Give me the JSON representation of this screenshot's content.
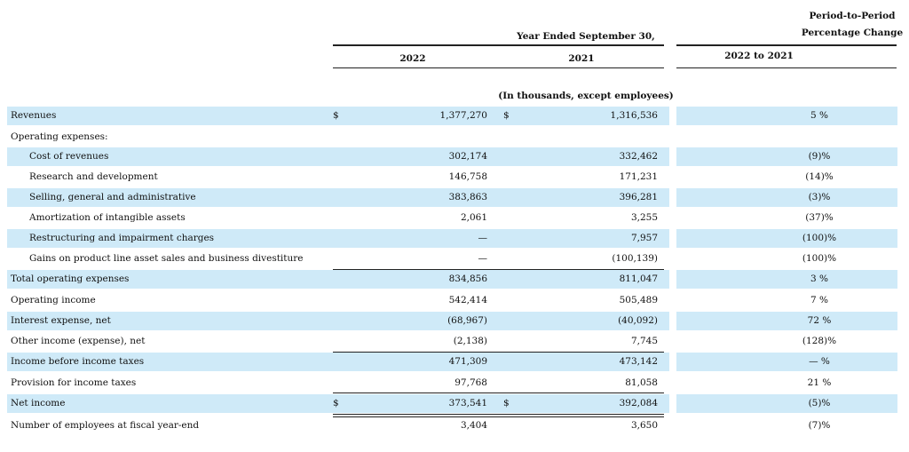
{
  "header": {
    "period_to_period_line1": "Period-to-Period",
    "period_to_period_line2": "Percentage Change",
    "year_ended": "Year Ended September 30,",
    "col_2022": "2022",
    "col_2021": "2021",
    "col_change": "2022 to 2021",
    "units_note": "(In thousands, except employees)"
  },
  "rows": [
    {
      "label": "Revenues",
      "d1": "$",
      "v2022": "1,377,270",
      "d2": "$",
      "v2021": "1,316,536",
      "pct": "5 %"
    },
    {
      "label": "Operating expenses:",
      "d1": "",
      "v2022": "",
      "d2": "",
      "v2021": "",
      "pct": ""
    },
    {
      "label": "Cost of revenues",
      "d1": "",
      "v2022": "302,174",
      "d2": "",
      "v2021": "332,462",
      "pct": "(9)%"
    },
    {
      "label": "Research and development",
      "d1": "",
      "v2022": "146,758",
      "d2": "",
      "v2021": "171,231",
      "pct": "(14)%"
    },
    {
      "label": "Selling, general and administrative",
      "d1": "",
      "v2022": "383,863",
      "d2": "",
      "v2021": "396,281",
      "pct": "(3)%"
    },
    {
      "label": "Amortization of intangible assets",
      "d1": "",
      "v2022": "2,061",
      "d2": "",
      "v2021": "3,255",
      "pct": "(37)%"
    },
    {
      "label": "Restructuring and impairment charges",
      "d1": "",
      "v2022": "—",
      "d2": "",
      "v2021": "7,957",
      "pct": "(100)%"
    },
    {
      "label": "Gains on product line asset sales and business divestiture",
      "d1": "",
      "v2022": "—",
      "d2": "",
      "v2021": "(100,139)",
      "pct": "(100)%"
    },
    {
      "label": "Total operating expenses",
      "d1": "",
      "v2022": "834,856",
      "d2": "",
      "v2021": "811,047",
      "pct": "3 %"
    },
    {
      "label": "Operating income",
      "d1": "",
      "v2022": "542,414",
      "d2": "",
      "v2021": "505,489",
      "pct": "7 %"
    },
    {
      "label": "Interest expense, net",
      "d1": "",
      "v2022": "(68,967)",
      "d2": "",
      "v2021": "(40,092)",
      "pct": "72 %"
    },
    {
      "label": "Other income (expense), net",
      "d1": "",
      "v2022": "(2,138)",
      "d2": "",
      "v2021": "7,745",
      "pct": "(128)%"
    },
    {
      "label": "Income before income taxes",
      "d1": "",
      "v2022": "471,309",
      "d2": "",
      "v2021": "473,142",
      "pct": "— %"
    },
    {
      "label": "Provision for income taxes",
      "d1": "",
      "v2022": "97,768",
      "d2": "",
      "v2021": "81,058",
      "pct": "21 %"
    },
    {
      "label": "Net income",
      "d1": "$",
      "v2022": "373,541",
      "d2": "$",
      "v2021": "392,084",
      "pct": "(5)%"
    },
    {
      "label": "Number of employees at fiscal year-end",
      "d1": "",
      "v2022": "3,404",
      "d2": "",
      "v2021": "3,650",
      "pct": "(7)%"
    }
  ]
}
